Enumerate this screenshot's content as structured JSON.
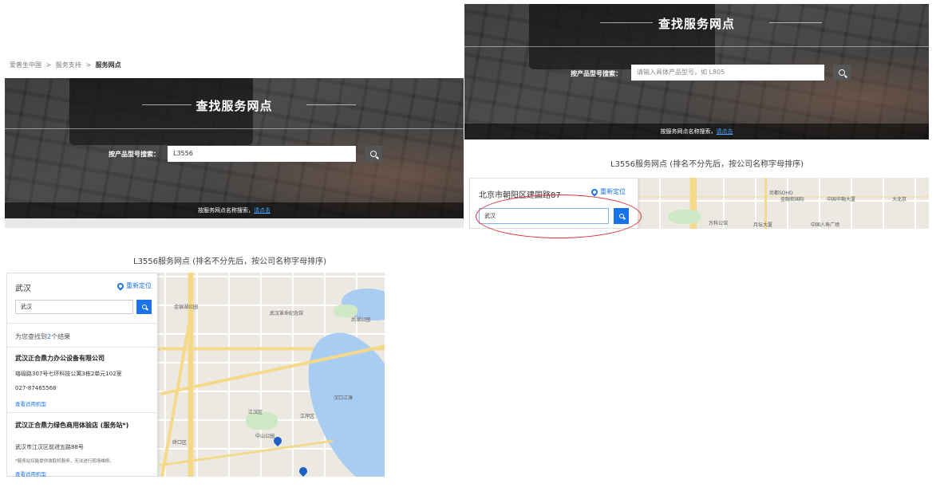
{
  "breadcrumb": {
    "items": [
      "爱普生中国",
      "服务支持",
      "服务网点"
    ],
    "separator": ">"
  },
  "hero": {
    "title": "查找服务网点",
    "search_label": "按产品型号搜索：",
    "search_value": "L3556",
    "search_placeholder": "请输入具体产品型号，如 L805",
    "bottom_text": "按服务网点名称搜索，",
    "bottom_link": "请点击"
  },
  "results_caption": "L3556服务网点 (排名不分先后，按公司名称字母排序)",
  "top_panel": {
    "city": "北京市朝阳区建国路87",
    "relocate": "重新定位",
    "input_value": "武汉",
    "map_labels": [
      "金融街国际",
      "中国华融大厦",
      "尚都SOHO",
      "大北京",
      "中国人寿广场",
      "万科公馆",
      "月坛大厦"
    ]
  },
  "bottom_panel": {
    "city": "武汉",
    "relocate": "重新定位",
    "input_value": "武汉",
    "result_prefix": "为您查找到",
    "result_count": "2",
    "result_suffix": "个结果",
    "stores": [
      {
        "name": "武汉正合鼎力办公设备有限公司",
        "address": "珞喻路307号七环科技公寓3栋2单元102室",
        "phone": "027-87465568",
        "link": "查看适用机型"
      },
      {
        "name": "武汉正合鼎力绿色商用体验店 (服务站*)",
        "address": "武汉市江汉区前进五路88号",
        "note": "*服务站仅能提供收取机服务，无法进行现场维修。",
        "link": "查看适用机型"
      }
    ],
    "map_labels": [
      "金银湖公园",
      "武汉革命纪念馆",
      "中山公园",
      "江汉区",
      "江岸区",
      "硚口区",
      "汉口江滩",
      "后湖公园"
    ]
  },
  "colors": {
    "accent": "#1a73e8",
    "highlight": "#d33333"
  }
}
